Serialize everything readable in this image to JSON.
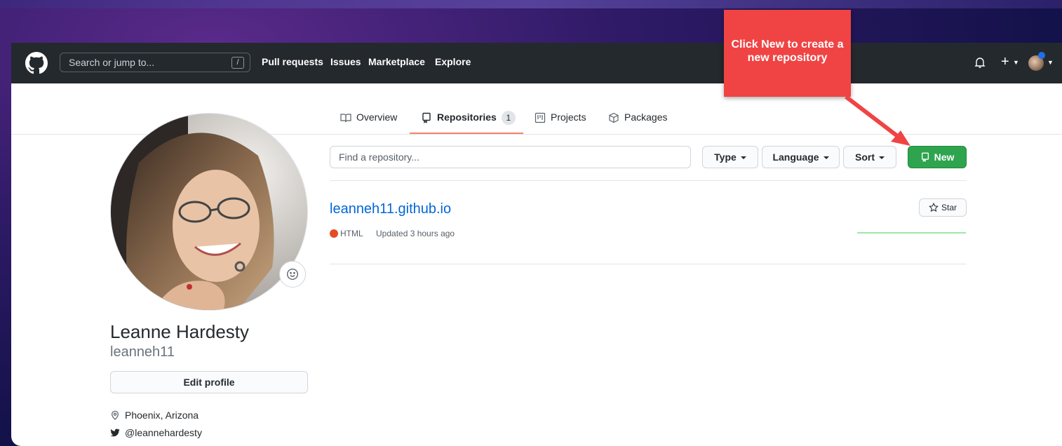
{
  "header": {
    "search_placeholder": "Search or jump to...",
    "search_shortcut": "/",
    "nav": [
      "Pull requests",
      "Issues",
      "Marketplace",
      "Explore"
    ],
    "icons": [
      "github-logo-icon",
      "bell-icon",
      "plus-icon",
      "chevron-down-icon"
    ]
  },
  "tabs": [
    {
      "label": "Overview",
      "icon": "book-icon"
    },
    {
      "label": "Repositories",
      "icon": "repo-icon",
      "count": "1"
    },
    {
      "label": "Projects",
      "icon": "project-icon"
    },
    {
      "label": "Packages",
      "icon": "package-icon"
    }
  ],
  "profile": {
    "full_name": "Leanne Hardesty",
    "username": "leanneh11",
    "edit_label": "Edit profile",
    "location": "Phoenix, Arizona",
    "twitter": "@leannehardesty"
  },
  "repo_filters": {
    "find_placeholder": "Find a repository...",
    "type_label": "Type",
    "language_label": "Language",
    "sort_label": "Sort",
    "new_label": "New"
  },
  "repos": [
    {
      "name": "leanneh11.github.io",
      "language": "HTML",
      "language_color": "#e34c26",
      "updated": "Updated 3 hours ago",
      "star_label": "Star"
    }
  ],
  "annotation": {
    "text": "Click New to create a new repository",
    "color": "#f04444"
  },
  "colors": {
    "header_bg": "#24292e",
    "accent_green": "#2ea44f",
    "link_blue": "#0366d6",
    "tab_underline": "#f9826c"
  }
}
